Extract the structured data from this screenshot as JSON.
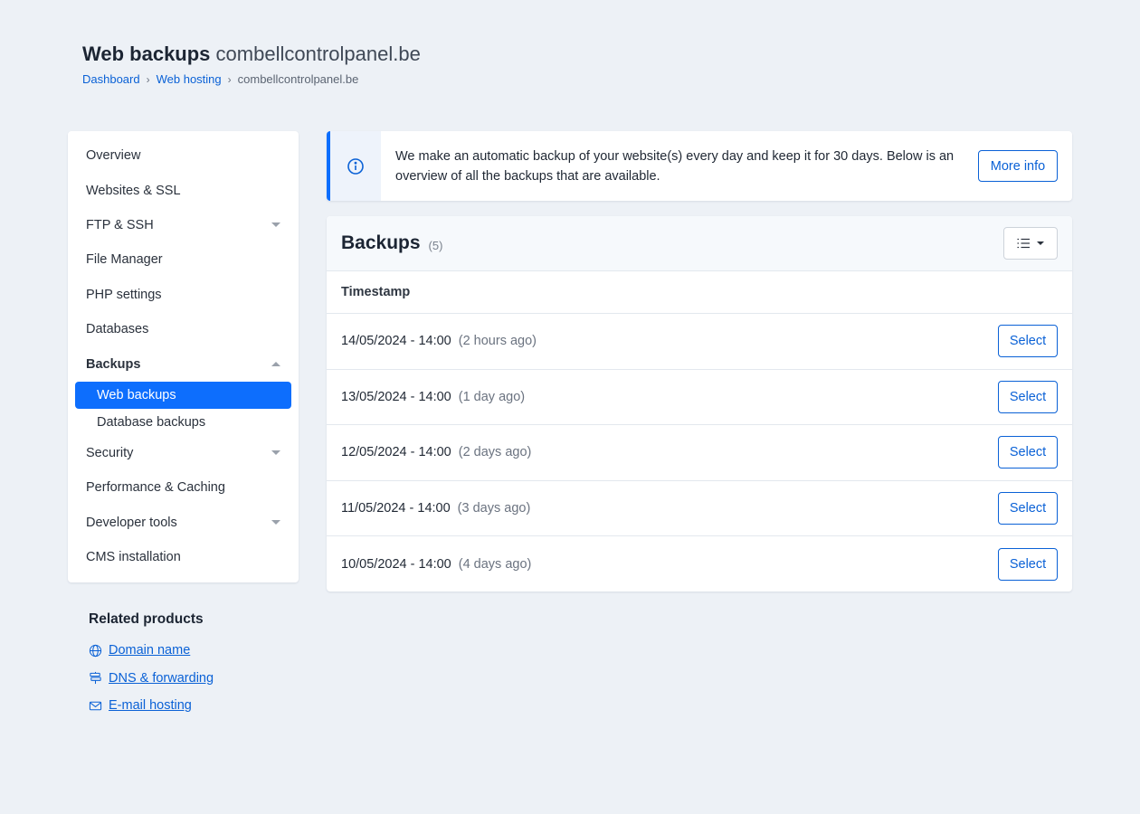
{
  "header": {
    "title": "Web backups",
    "domain": "combellcontrolpanel.be",
    "breadcrumb": [
      "Dashboard",
      "Web hosting",
      "combellcontrolpanel.be"
    ]
  },
  "sidebar": {
    "items": [
      {
        "label": "Overview"
      },
      {
        "label": "Websites & SSL"
      },
      {
        "label": "FTP & SSH"
      },
      {
        "label": "File Manager"
      },
      {
        "label": "PHP settings"
      },
      {
        "label": "Databases"
      },
      {
        "label": "Backups"
      },
      {
        "label": "Security"
      },
      {
        "label": "Performance & Caching"
      },
      {
        "label": "Developer tools"
      },
      {
        "label": "CMS installation"
      }
    ],
    "backups_sub": [
      "Web backups",
      "Database backups"
    ]
  },
  "related": {
    "title": "Related products",
    "links": [
      {
        "label": "Domain name",
        "icon": "globe-icon"
      },
      {
        "label": "DNS & forwarding",
        "icon": "signpost-icon"
      },
      {
        "label": "E-mail hosting",
        "icon": "envelope-icon"
      }
    ]
  },
  "info": {
    "text": "We make an automatic backup of your website(s) every day and keep it for 30 days. Below is an overview of all the backups that are available.",
    "button": "More info",
    "icon": "info-icon"
  },
  "backups": {
    "title": "Backups",
    "count": "(5)",
    "column": "Timestamp",
    "select_label": "Select",
    "rows": [
      {
        "timestamp": "14/05/2024 - 14:00",
        "ago": "(2 hours ago)"
      },
      {
        "timestamp": "13/05/2024 - 14:00",
        "ago": "(1 day ago)"
      },
      {
        "timestamp": "12/05/2024 - 14:00",
        "ago": "(2 days ago)"
      },
      {
        "timestamp": "11/05/2024 - 14:00",
        "ago": "(3 days ago)"
      },
      {
        "timestamp": "10/05/2024 - 14:00",
        "ago": "(4 days ago)"
      }
    ]
  },
  "colors": {
    "accent": "#0d6efd",
    "link": "#0a61d6",
    "background": "#edf1f6"
  }
}
